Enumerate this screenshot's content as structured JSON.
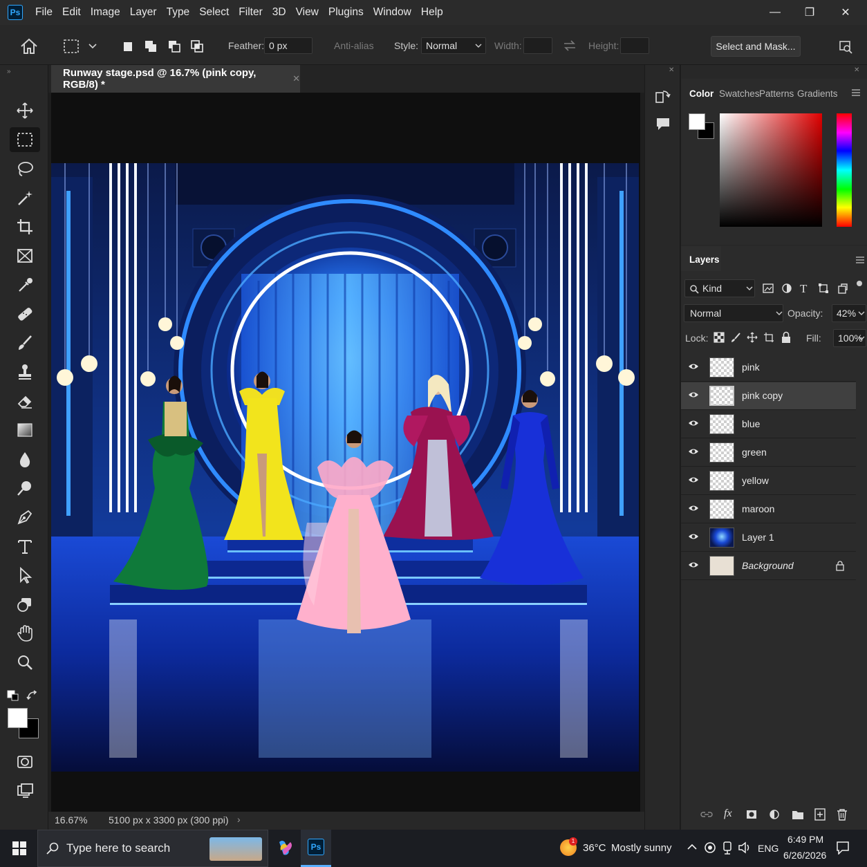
{
  "app": {
    "logo": "Ps"
  },
  "menu": [
    "File",
    "Edit",
    "Image",
    "Layer",
    "Type",
    "Select",
    "Filter",
    "3D",
    "View",
    "Plugins",
    "Window",
    "Help"
  ],
  "window_controls": {
    "minimize": "—",
    "restore": "❐",
    "close": "✕"
  },
  "options": {
    "feather_label": "Feather:",
    "feather_value": "0 px",
    "antialias_label": "Anti-alias",
    "style_label": "Style:",
    "style_value": "Normal",
    "width_label": "Width:",
    "height_label": "Height:",
    "select_mask": "Select and Mask..."
  },
  "document": {
    "tab_title": "Runway stage.psd @ 16.7% (pink copy, RGB/8) *",
    "zoom": "16.67%",
    "dimensions": "5100 px x 3300 px (300 ppi)"
  },
  "color_panel": {
    "tabs": [
      "Color",
      "Swatches",
      "Patterns",
      "Gradients"
    ],
    "active_tab": "Color",
    "foreground": "#ffffff",
    "background": "#000000",
    "hue_color": "#e00000"
  },
  "layers_panel": {
    "title": "Layers",
    "filter_label": "Kind",
    "blend_mode": "Normal",
    "opacity_label": "Opacity:",
    "opacity_value": "42%",
    "lock_label": "Lock:",
    "fill_label": "Fill:",
    "fill_value": "100%",
    "layers": [
      {
        "name": "pink",
        "selected": false
      },
      {
        "name": "pink copy",
        "selected": true
      },
      {
        "name": "blue",
        "selected": false
      },
      {
        "name": "green",
        "selected": false
      },
      {
        "name": "yellow",
        "selected": false
      },
      {
        "name": "maroon",
        "selected": false
      },
      {
        "name": "Layer 1",
        "selected": false
      },
      {
        "name": "Background",
        "selected": false,
        "locked": true
      }
    ]
  },
  "taskbar": {
    "search_placeholder": "Type here to search",
    "weather_temp": "36°C",
    "weather_desc": "Mostly sunny",
    "language": "ENG",
    "time": "6:49 PM",
    "date": "6/26/2026",
    "weather_badge": "1"
  }
}
